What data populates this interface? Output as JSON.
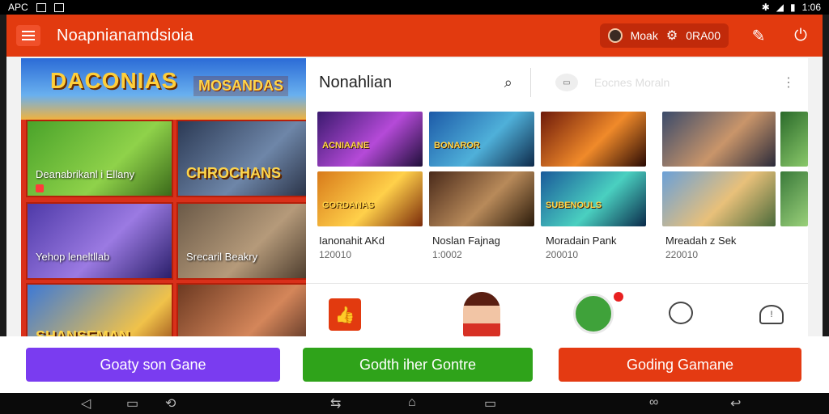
{
  "status_bar": {
    "carrier": "APC",
    "time": "1:06"
  },
  "app_bar": {
    "title": "Noapnianamdsioia",
    "user_name": "Moak",
    "coins_label": "0RA00"
  },
  "left_panel": {
    "banner_title": "DACONIAS",
    "banner_badge": "MOSANDAS",
    "tiles": [
      {
        "label": "Deanabrikanl i Ellany"
      },
      {
        "label": "CHROCHANS"
      },
      {
        "label": "Yehop leneltllab"
      },
      {
        "label": "Srecaril Beakry"
      },
      {
        "label": "SHANSEMAN"
      },
      {
        "label": ""
      }
    ]
  },
  "right_panel": {
    "title": "Nonahlian",
    "search_placeholder": "Eocnes Moraln",
    "games": [
      {
        "name": "Ianonahit AKd",
        "count": "120010"
      },
      {
        "name": "Noslan Fajnag",
        "count": "1:0002"
      },
      {
        "name": "Moradain Pank",
        "count": "200010"
      },
      {
        "name": "Mreadah z Sek",
        "count": "220010"
      }
    ],
    "card_texts": [
      "ACNIAANE",
      "BONAROR",
      "",
      "",
      "GORDANAS",
      "",
      "SUBENOULS",
      ""
    ]
  },
  "actions": {
    "btn1": "Goaty son Gane",
    "btn2": "Godth iher Gontre",
    "btn3": "Goding Gamane"
  },
  "colors": {
    "brand_red": "#e23a0f",
    "purple": "#7a3cf0",
    "green": "#2fa31a",
    "orange_red": "#e43a12"
  }
}
